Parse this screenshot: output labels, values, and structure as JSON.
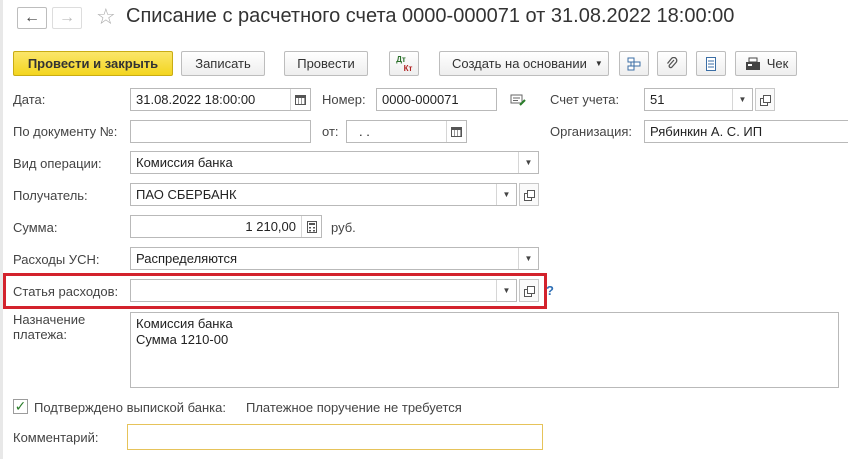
{
  "window": {
    "title": "Списание с расчетного счета 0000-000071 от 31.08.2022 18:00:00"
  },
  "toolbar": {
    "post_and_close": "Провести и закрыть",
    "save": "Записать",
    "post": "Провести",
    "dt_kt_top": "Дт",
    "dt_kt_bottom": "Кт",
    "create_based_on": "Создать на основании",
    "receipt": "Чек"
  },
  "form": {
    "date_label": "Дата:",
    "date_value": "31.08.2022 18:00:00",
    "number_label": "Номер:",
    "number_value": "0000-000071",
    "account_label": "Счет учета:",
    "account_value": "51",
    "by_document_label": "По документу №:",
    "by_document_value": "",
    "from_label": "от:",
    "from_value": " .  .",
    "organization_label": "Организация:",
    "organization_value": "Рябинкин А. С. ИП",
    "operation_label": "Вид операции:",
    "operation_value": "Комиссия банка",
    "recipient_label": "Получатель:",
    "recipient_value": "ПАО СБЕРБАНК",
    "amount_label": "Сумма:",
    "amount_value": "1 210,00",
    "currency": "руб.",
    "usn_label": "Расходы УСН:",
    "usn_value": "Распределяются",
    "expense_item_label": "Статья расходов:",
    "expense_item_value": "",
    "help_mark": "?",
    "purpose_label_1": "Назначение",
    "purpose_label_2": "платежа:",
    "purpose_line_1": "Комиссия банка",
    "purpose_line_2": "Сумма 1210-00",
    "confirmed_label": "Подтверждено выпиской банка:",
    "payment_order_note": "Платежное поручение не требуется",
    "comment_label": "Комментарий:",
    "comment_value": ""
  },
  "colors": {
    "primary_button": "#f3d51f",
    "highlight_border": "#d3222c",
    "comment_border": "#e6c35a",
    "help_mark": "#2f6fb5"
  },
  "icons": [
    "back-arrow-icon",
    "forward-arrow-icon",
    "favorite-star-icon",
    "structure-icon",
    "paperclip-icon",
    "print-list-icon",
    "cash-register-icon",
    "calendar-icon",
    "dropdown-arrow-icon",
    "open-form-icon",
    "calculator-icon",
    "checkmark-icon"
  ]
}
